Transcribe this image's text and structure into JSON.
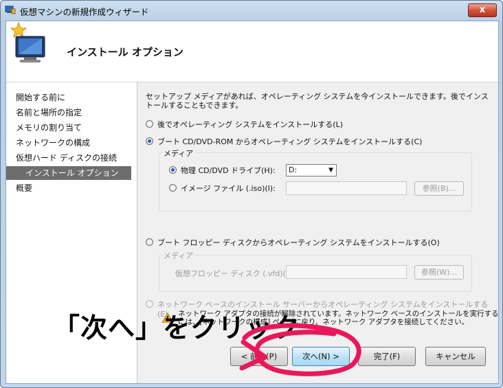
{
  "window": {
    "title": "仮想マシンの新規作成ウィザード",
    "close_glyph": "x"
  },
  "header": {
    "title": "インストール オプション"
  },
  "sidebar": {
    "items": [
      {
        "label": "開始する前に",
        "active": false
      },
      {
        "label": "名前と場所の指定",
        "active": false
      },
      {
        "label": "メモリの割り当て",
        "active": false
      },
      {
        "label": "ネットワークの構成",
        "active": false
      },
      {
        "label": "仮想ハード ディスクの接続",
        "active": false
      },
      {
        "label": "インストール オプション",
        "active": true
      },
      {
        "label": "概要",
        "active": false
      }
    ]
  },
  "content": {
    "description": "セットアップ メディアがあれば、オペレーティング システムを今インストールできます。後でインストールすることもできます。",
    "options": {
      "later": "後でオペレーティング システムをインストールする(L)",
      "boot_cd": "ブート CD/DVD-ROM からオペレーティング システムをインストールする(C)",
      "boot_floppy": "ブート フロッピー ディスクからオペレーティング システムをインストールする(O)",
      "network": "ネットワーク ベースのインストール サーバーからオペレーティング システムをインストールする(E)"
    },
    "cd_group": {
      "caption": "メディア",
      "physical_label": "物理 CD/DVD ドライブ(H):",
      "physical_value": "D:",
      "image_label": "イメージ ファイル (.iso)(I):",
      "browse": "参照(B)..."
    },
    "floppy_group": {
      "caption": "メディア",
      "file_label": "仮想フロッピー ディスク (.vfd)(V):",
      "browse": "参照(W)..."
    },
    "warning": "ネットワーク アダプタの接続が解除されています。ネットワーク ベースのインストールを実行するには、[ネットワークの構成] ページに戻り、ネットワーク アダプタを接続してください。"
  },
  "buttons": {
    "back": "< 前へ(P)",
    "next": "次へ(N) >",
    "finish": "完了(F)",
    "cancel": "キャンセル"
  },
  "annotation": {
    "text": "「次へ」をクリック",
    "color": "#e8185a"
  },
  "colors": {
    "active_nav": "#6d6d6d",
    "accent": "#2a5ea8",
    "scribble": "#e8185a"
  }
}
